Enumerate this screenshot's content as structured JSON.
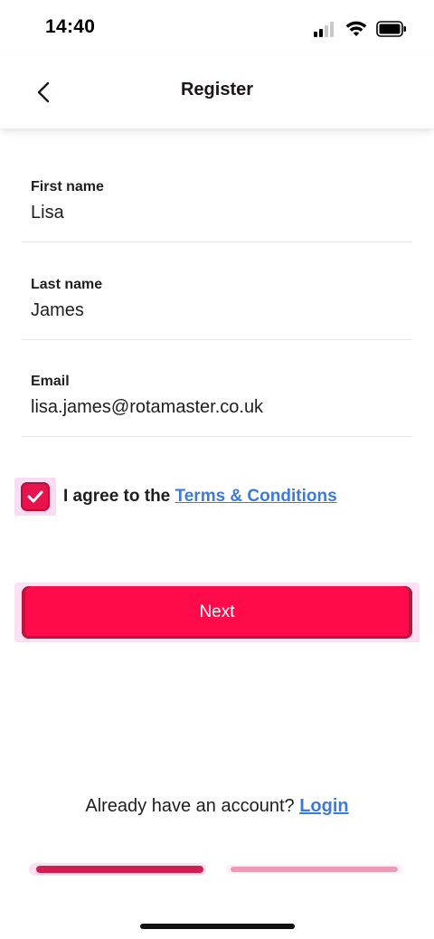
{
  "status_bar": {
    "time": "14:40"
  },
  "header": {
    "title": "Register"
  },
  "form": {
    "first_name": {
      "label": "First name",
      "value": "Lisa"
    },
    "last_name": {
      "label": "Last name",
      "value": "James"
    },
    "email": {
      "label": "Email",
      "value": "lisa.james@rotamaster.co.uk"
    },
    "agree": {
      "checked": true,
      "prefix": "I agree to the ",
      "link": "Terms & Conditions"
    },
    "next_label": "Next"
  },
  "footer": {
    "login_prompt": "Already have an account? ",
    "login_link": "Login"
  },
  "progress": {
    "step": 1,
    "total_steps": 2
  },
  "colors": {
    "accent": "#ff0a4b",
    "checkbox": "#e8124c",
    "link": "#3d7bd9",
    "step_active": "#d21f51",
    "step_inactive": "#ee9ab6"
  },
  "icons": {
    "back": "chevron-left-icon",
    "signal": "cellular-signal-icon",
    "wifi": "wifi-icon",
    "battery": "battery-icon",
    "check": "checkmark-icon"
  }
}
